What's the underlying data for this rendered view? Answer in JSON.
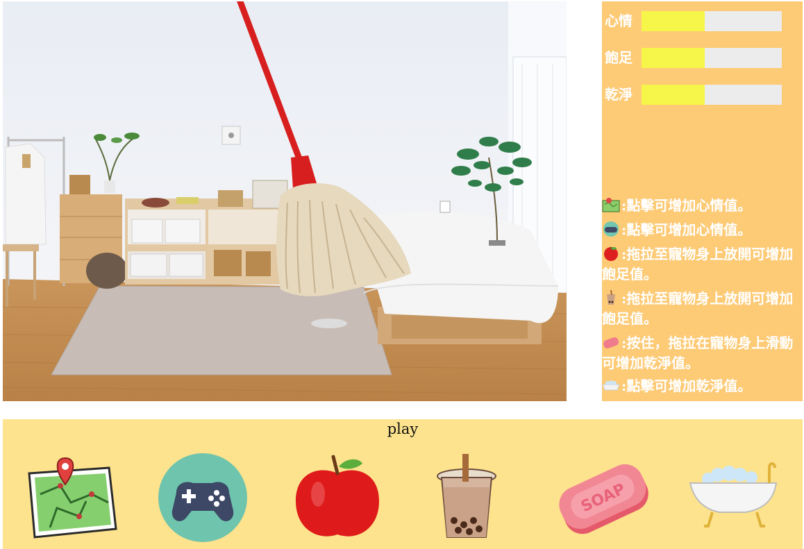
{
  "stats": {
    "mood": {
      "label": "心情",
      "level": 0.45
    },
    "fullness": {
      "label": "飽足",
      "level": 0.45
    },
    "cleanliness": {
      "label": "乾淨",
      "level": 0.45
    }
  },
  "instructions": [
    {
      "icon": "map-icon",
      "text": ":點擊可增加心情值。"
    },
    {
      "icon": "gamepad-icon",
      "text": ":點擊可增加心情值。"
    },
    {
      "icon": "apple-icon",
      "text": ":拖拉至寵物身上放開可增加飽足值。"
    },
    {
      "icon": "bubble-tea-icon",
      "text": ":拖拉至寵物身上放開可增加飽足值。"
    },
    {
      "icon": "soap-icon",
      "text": ":按住，拖拉在寵物身上滑動可增加乾淨值。"
    },
    {
      "icon": "bathtub-icon",
      "text": ":點擊可增加乾淨值。"
    }
  ],
  "toolbar": {
    "label": "play",
    "tools": [
      "map-icon",
      "gamepad-icon",
      "apple-icon",
      "bubble-tea-icon",
      "soap-icon",
      "bathtub-icon"
    ]
  },
  "scene": {
    "cursor": "mop"
  },
  "colors": {
    "panel": "#fdca75",
    "toolbar": "#fde38d",
    "bar_fill": "#f6f64a",
    "bar_track": "#ececec"
  }
}
